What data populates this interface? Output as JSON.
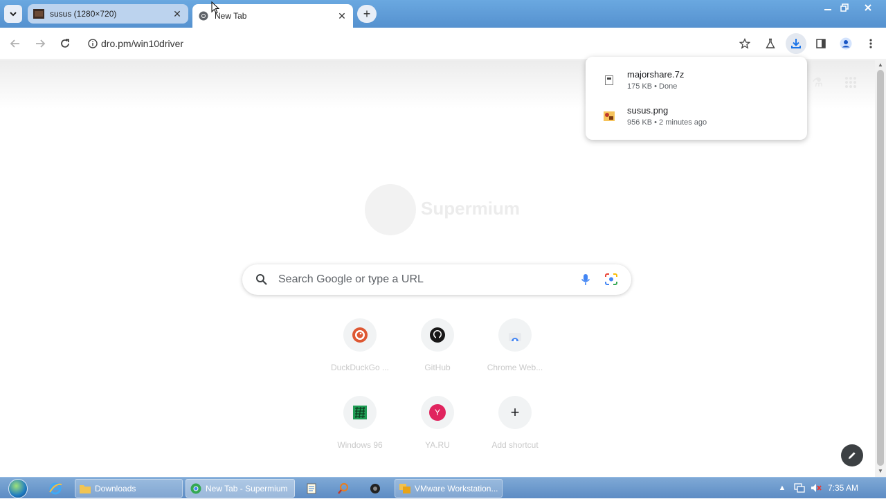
{
  "tabs": [
    {
      "title": "susus (1280×720)",
      "active": false
    },
    {
      "title": "New Tab",
      "active": true
    }
  ],
  "omnibox": {
    "url": "dro.pm/win10driver"
  },
  "ntp": {
    "logo_text": "Supermium",
    "search_placeholder": "Search Google or type a URL",
    "shortcuts": [
      {
        "name": "DuckDuckGo ...",
        "icon": "duckduckgo-icon"
      },
      {
        "name": "GitHub",
        "icon": "github-icon"
      },
      {
        "name": "Chrome Web...",
        "icon": "chrome-web-store-icon"
      },
      {
        "name": "Windows 96",
        "icon": "windows96-icon"
      },
      {
        "name": "YA.RU",
        "icon": "ya-ru-icon",
        "letter": "Y"
      },
      {
        "name": "Add shortcut",
        "icon": "plus-icon"
      }
    ]
  },
  "downloads": [
    {
      "name": "majorshare.7z",
      "meta": "175 KB • Done"
    },
    {
      "name": "susus.png",
      "meta": "956 KB • 2 minutes ago"
    }
  ],
  "taskbar": {
    "buttons": [
      {
        "label": "Downloads",
        "icon": "folder-icon"
      },
      {
        "label": "New Tab - Supermium",
        "icon": "supermium-icon"
      },
      {
        "label": "VMware Workstation...",
        "icon": "vmware-icon"
      }
    ],
    "clock": "7:35 AM"
  },
  "colors": {
    "titlebar": "#5591cf",
    "taskbar": "#5d8cc4",
    "accent_download": "#1a73e8",
    "ya_badge": "#e0245e"
  }
}
